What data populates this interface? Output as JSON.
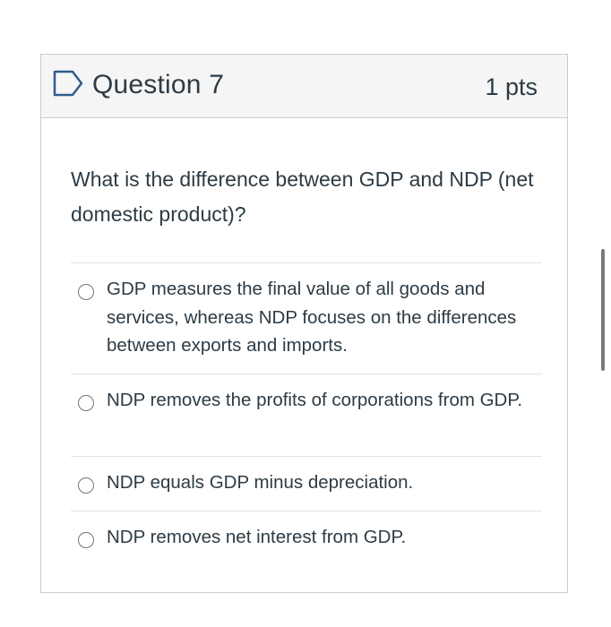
{
  "question": {
    "title": "Question 7",
    "points": "1 pts",
    "flag_icon": "flag-outline-icon",
    "text": "What is the difference between GDP and NDP (net domestic product)?"
  },
  "answers": [
    {
      "label": "GDP measures the final value of all goods and services, whereas NDP focuses on the differences between exports and imports.",
      "selected": false
    },
    {
      "label": "NDP removes the profits of corporations from GDP.",
      "selected": false
    },
    {
      "label": "NDP equals GDP minus depreciation.",
      "selected": false
    },
    {
      "label": "NDP removes net interest from GDP.",
      "selected": false
    }
  ],
  "colors": {
    "text": "#2d3b45",
    "border": "#c7cdd1",
    "header_bg": "#f5f5f5",
    "divider": "#dfe3e6",
    "radio_border": "#6b7780",
    "flag_stroke": "#2f5d8c"
  }
}
